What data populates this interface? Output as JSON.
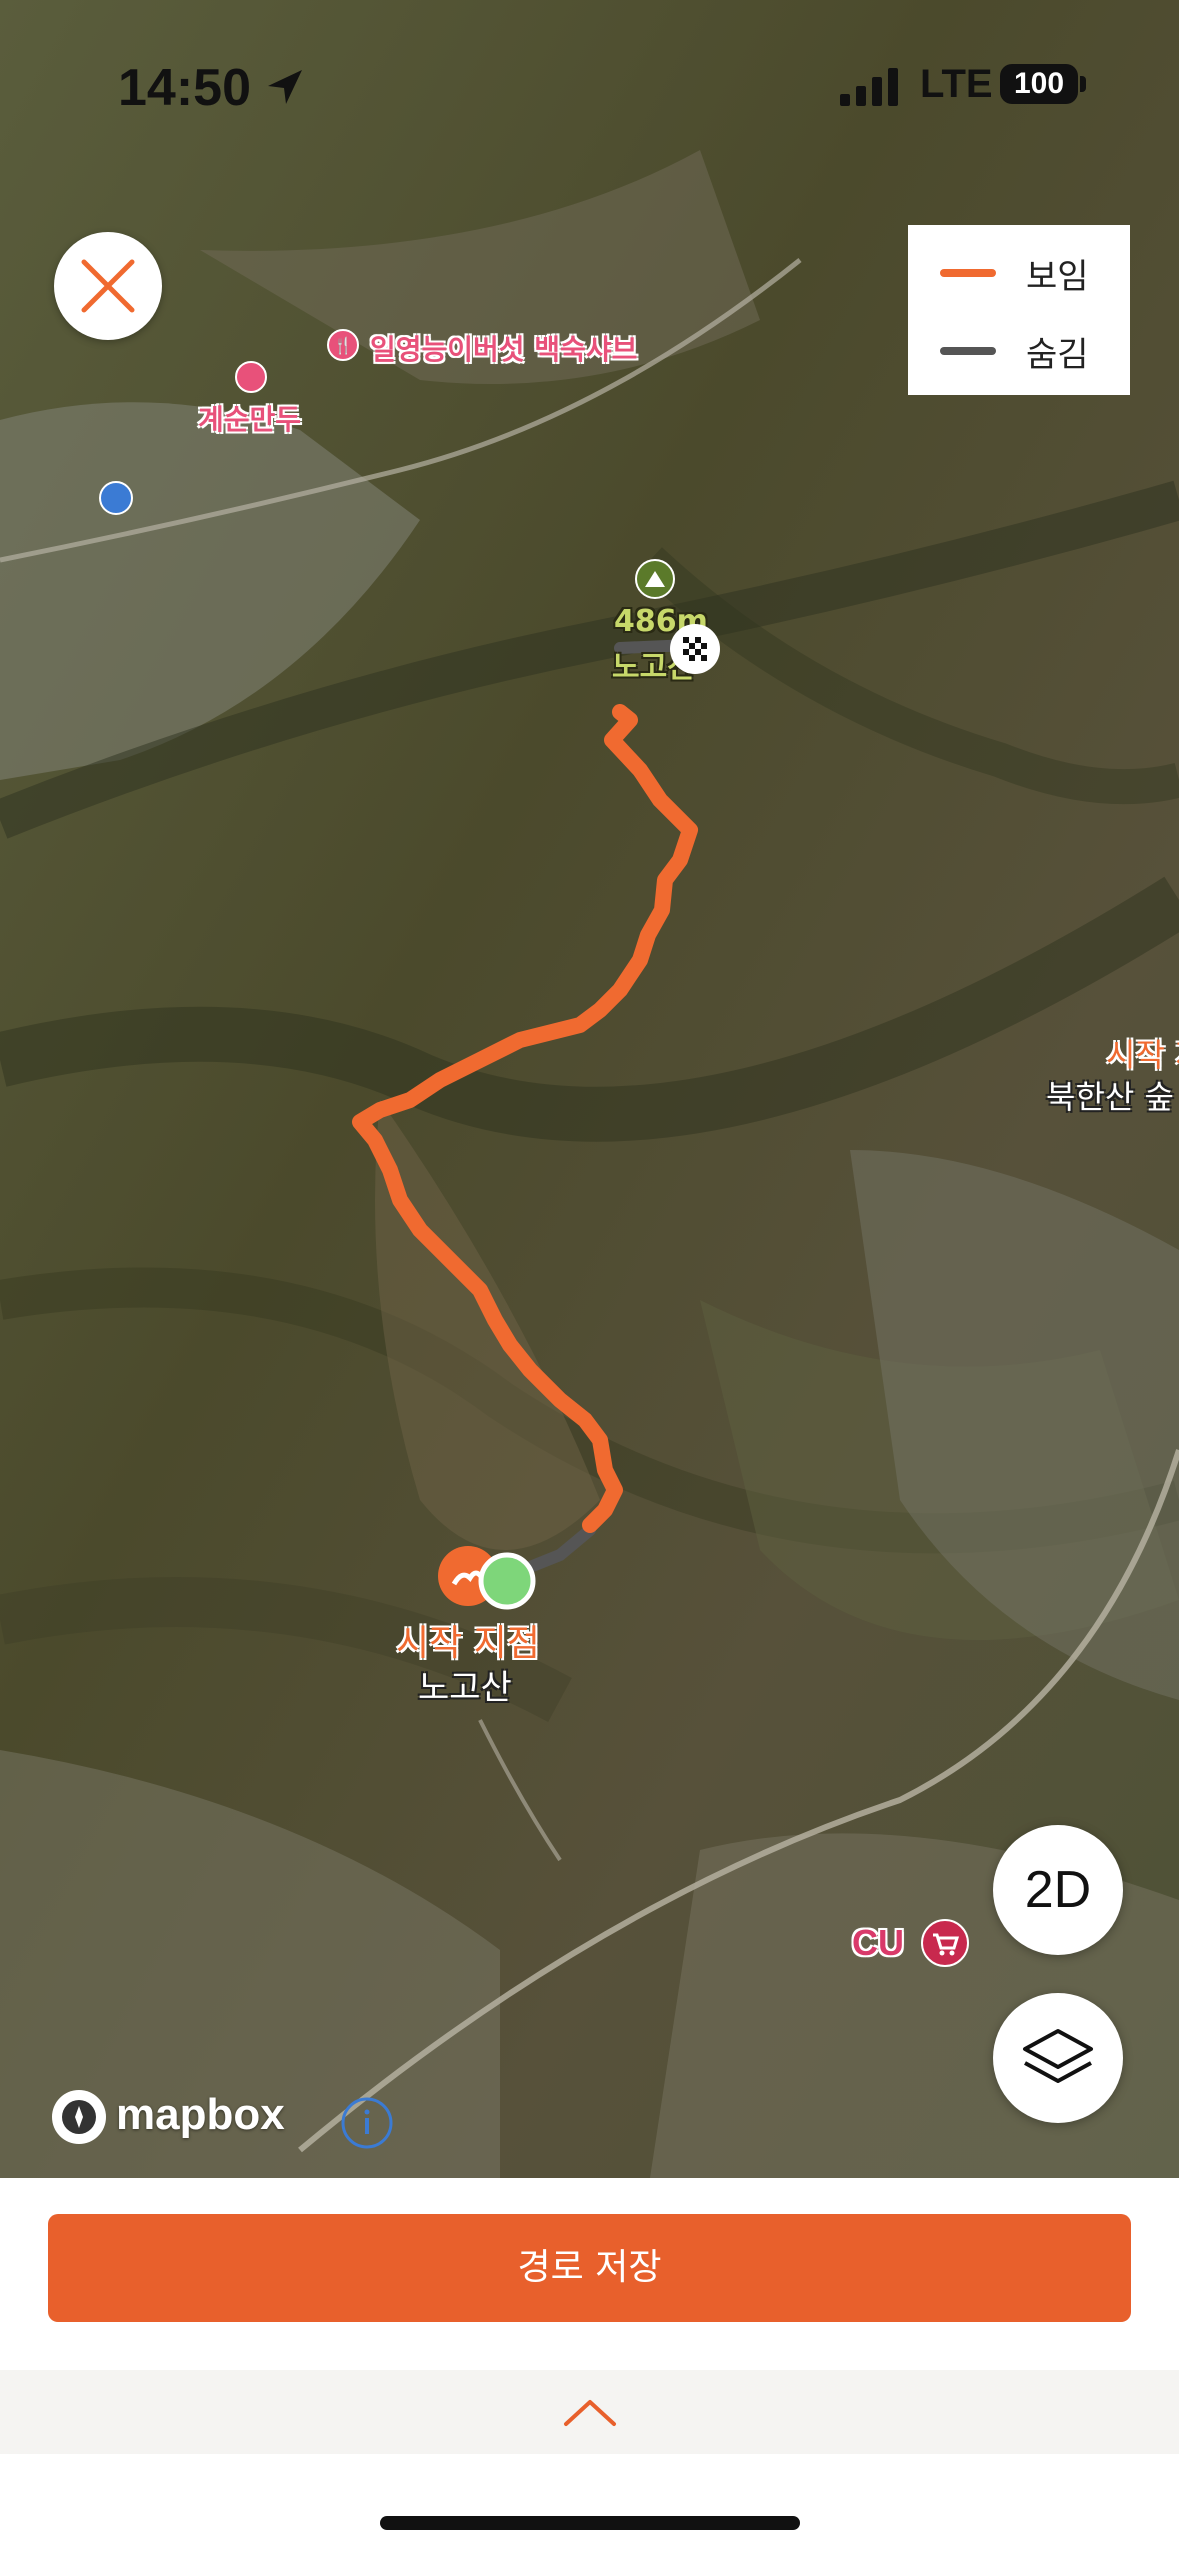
{
  "status_bar": {
    "time": "14:50",
    "network": "LTE",
    "battery": "100"
  },
  "legend": {
    "items": [
      {
        "label": "보임",
        "color": "#f06a30"
      },
      {
        "label": "숨김",
        "color": "#555555"
      }
    ]
  },
  "map": {
    "pois": {
      "restaurant_1": "일영능이버섯 백숙샤브",
      "restaurant_2": "계순만두",
      "peak_elevation": "486m",
      "peak_name": "노고산",
      "start_label": "시작 지점",
      "start_name": "노고산",
      "edge_start_label": "시작 지",
      "edge_trail_name": "북한산 숲",
      "store": "CU"
    },
    "attribution": "mapbox",
    "colors": {
      "route_visible": "#f06a30",
      "route_hidden": "#555555",
      "start_marker": "#7ed67a"
    }
  },
  "controls": {
    "view_toggle": "2D",
    "layers_icon": "layers-icon",
    "close_icon": "close-icon"
  },
  "actions": {
    "save_route": "경로 저장"
  },
  "accent_color": "#e8602c"
}
